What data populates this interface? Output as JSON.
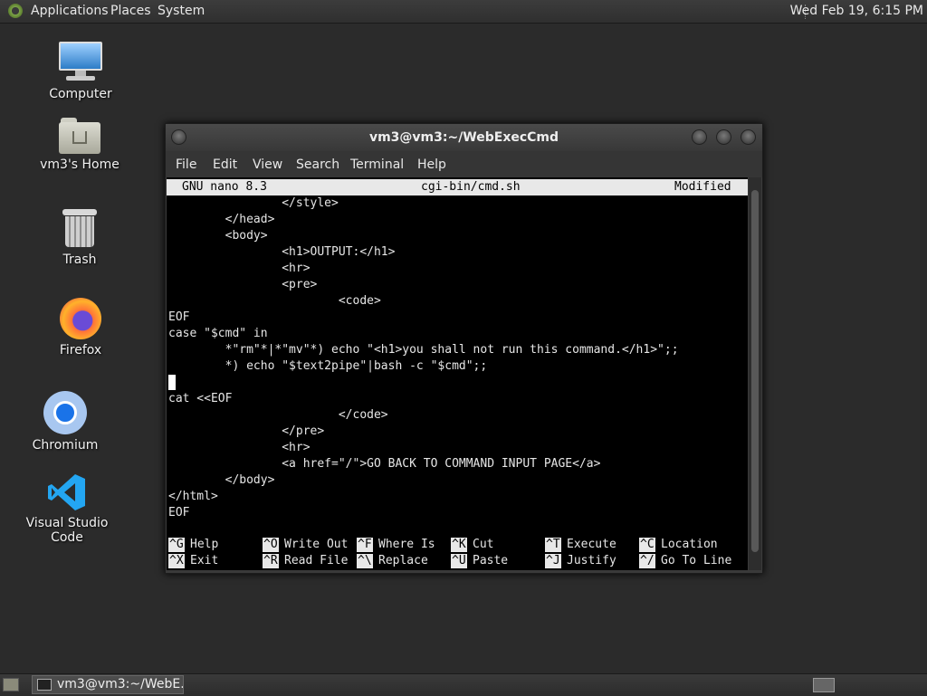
{
  "top_panel": {
    "menus": [
      "Applications",
      "Places",
      "System"
    ],
    "clock": "Wed Feb 19,  6:15 PM"
  },
  "desktop": {
    "icons": [
      {
        "label": "Computer",
        "icon": "computer-icon"
      },
      {
        "label": "vm3's Home",
        "icon": "home-folder-icon"
      },
      {
        "label": "Trash",
        "icon": "trash-icon"
      },
      {
        "label": "Firefox",
        "icon": "firefox-icon"
      },
      {
        "label": "Chromium",
        "icon": "chromium-icon"
      },
      {
        "label": "Visual Studio Code",
        "icon": "vscode-icon"
      }
    ]
  },
  "terminal": {
    "title": "vm3@vm3:~/WebExecCmd",
    "menu": [
      "File",
      "Edit",
      "View",
      "Search",
      "Terminal",
      "Help"
    ],
    "nano": {
      "version": "GNU nano 8.3",
      "filename": "cgi-bin/cmd.sh",
      "status": "Modified"
    },
    "lines": [
      "                </style>",
      "        </head>",
      "        <body>",
      "                <h1>OUTPUT:</h1>",
      "                <hr>",
      "                <pre>",
      "                        <code>",
      "EOF",
      "case \"$cmd\" in",
      "        *\"rm\"*|*\"mv\"*) echo \"<h1>you shall not run this command.</h1>\";;",
      "        *) echo \"$text2pipe\"|bash -c \"$cmd\";;",
      "",
      "cat <<EOF",
      "                        </code>",
      "                </pre>",
      "                <hr>",
      "                <a href=\"/\">GO BACK TO COMMAND INPUT PAGE</a>",
      "        </body>",
      "</html>",
      "EOF"
    ],
    "shortcuts_row1": [
      {
        "key": "^G",
        "label": "Help"
      },
      {
        "key": "^O",
        "label": "Write Out"
      },
      {
        "key": "^F",
        "label": "Where Is"
      },
      {
        "key": "^K",
        "label": "Cut"
      },
      {
        "key": "^T",
        "label": "Execute"
      },
      {
        "key": "^C",
        "label": "Location"
      }
    ],
    "shortcuts_row2": [
      {
        "key": "^X",
        "label": "Exit"
      },
      {
        "key": "^R",
        "label": "Read File"
      },
      {
        "key": "^\\",
        "label": "Replace"
      },
      {
        "key": "^U",
        "label": "Paste"
      },
      {
        "key": "^J",
        "label": "Justify"
      },
      {
        "key": "^/",
        "label": "Go To Line"
      }
    ]
  },
  "taskbar": {
    "task_label": "vm3@vm3:~/WebE..."
  }
}
